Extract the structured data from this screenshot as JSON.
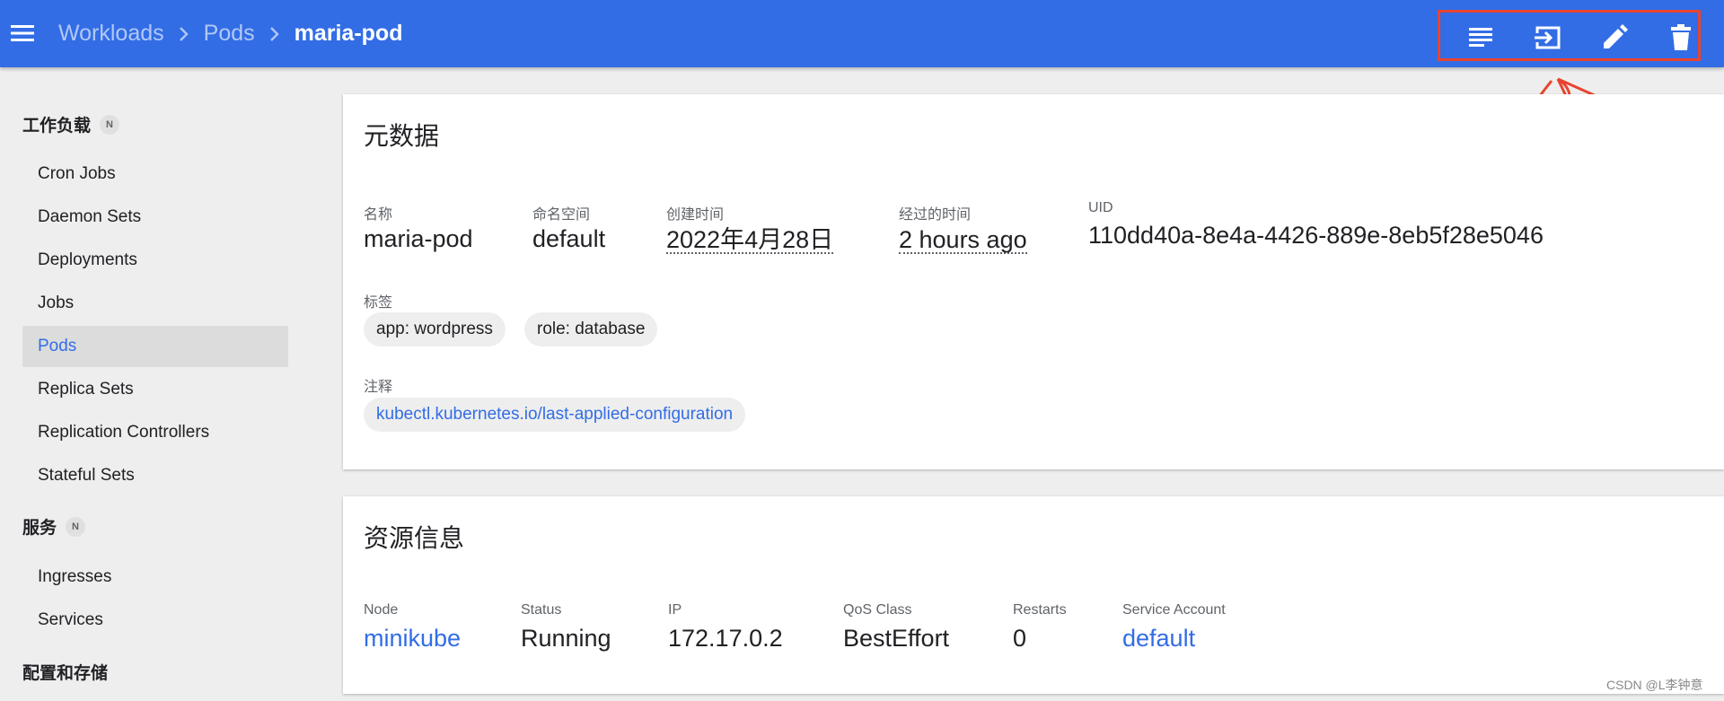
{
  "header": {
    "breadcrumbs": [
      "Workloads",
      "Pods",
      "maria-pod"
    ],
    "actions": [
      {
        "name": "logs-icon"
      },
      {
        "name": "exec-icon"
      },
      {
        "name": "edit-icon"
      },
      {
        "name": "delete-icon"
      }
    ]
  },
  "sidebar": {
    "groups": [
      {
        "title": "工作负载",
        "badge": "N",
        "items": [
          "Cron Jobs",
          "Daemon Sets",
          "Deployments",
          "Jobs",
          "Pods",
          "Replica Sets",
          "Replication Controllers",
          "Stateful Sets"
        ]
      },
      {
        "title": "服务",
        "badge": "N",
        "items": [
          "Ingresses",
          "Services"
        ]
      },
      {
        "title": "配置和存储"
      }
    ],
    "active_item": "Pods"
  },
  "metadata": {
    "title": "元数据",
    "fields": [
      {
        "label": "名称",
        "value": "maria-pod"
      },
      {
        "label": "命名空间",
        "value": "default"
      },
      {
        "label": "创建时间",
        "value": "2022年4月28日"
      },
      {
        "label": "经过的时间",
        "value": "2 hours ago"
      },
      {
        "label": "UID",
        "value": "110dd40a-8e4a-4426-889e-8eb5f28e5046"
      }
    ],
    "labels_title": "标签",
    "labels": [
      "app: wordpress",
      "role: database"
    ],
    "annotations_title": "注释",
    "annotations": [
      "kubectl.kubernetes.io/last-applied-configuration"
    ]
  },
  "resource": {
    "title": "资源信息",
    "fields": [
      {
        "label": "Node",
        "value": "minikube"
      },
      {
        "label": "Status",
        "value": "Running"
      },
      {
        "label": "IP",
        "value": "172.17.0.2"
      },
      {
        "label": "QoS Class",
        "value": "BestEffort"
      },
      {
        "label": "Restarts",
        "value": "0"
      },
      {
        "label": "Service Account",
        "value": "default"
      }
    ]
  },
  "watermark": "CSDN @L李钟意",
  "colors": {
    "header": "#326de6",
    "link": "#326de6",
    "annotation": "#e8442f"
  }
}
